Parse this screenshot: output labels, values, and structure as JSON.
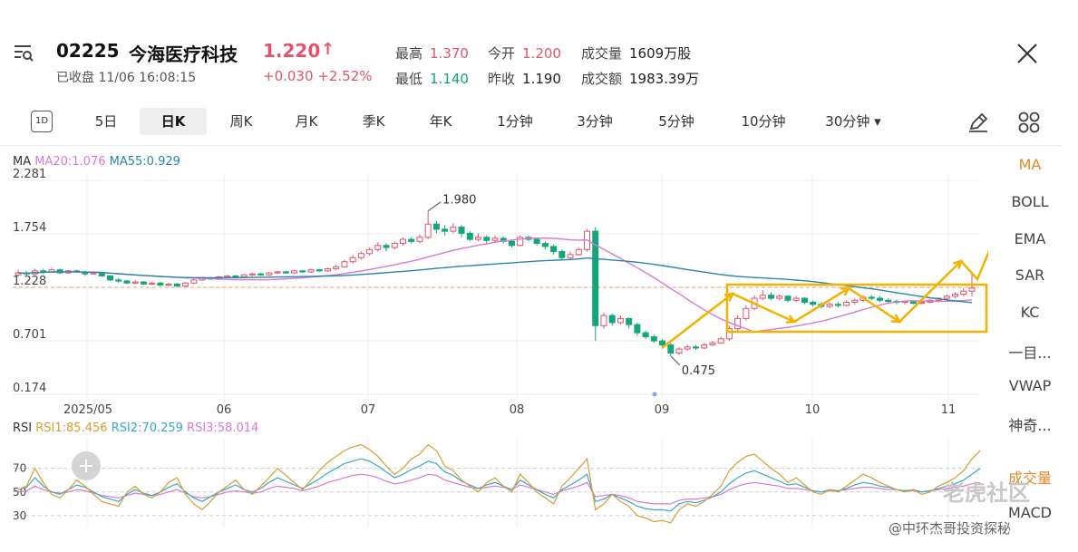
{
  "stock": {
    "code": "02225",
    "name": "今海医疗科技",
    "price": "1.220",
    "price_arrow": "↑",
    "status": "已收盘 11/06 16:08:15",
    "change": "+0.030 +2.52%"
  },
  "stats": {
    "high_label": "最高",
    "high_value": "1.370",
    "open_label": "今开",
    "open_value": "1.200",
    "volume_label": "成交量",
    "volume_value": "1609万股",
    "low_label": "最低",
    "low_value": "1.140",
    "prev_close_label": "昨收",
    "prev_close_value": "1.190",
    "turnover_label": "成交额",
    "turnover_value": "1983.39万"
  },
  "tabs": {
    "day1": "1D",
    "items": [
      "5日",
      "日K",
      "周K",
      "月K",
      "季K",
      "年K",
      "1分钟",
      "3分钟",
      "5分钟",
      "10分钟",
      "30分钟 ▾"
    ],
    "active": "日K"
  },
  "ma_legend": {
    "title": "MA",
    "ma20": "MA20:1.076",
    "ma55": "MA55:0.929"
  },
  "rsi_legend": {
    "title": "RSI",
    "rsi1": "RSI1:85.456",
    "rsi2": "RSI2:70.259",
    "rsi3": "RSI3:58.014"
  },
  "indicators": [
    "MA",
    "BOLL",
    "EMA",
    "SAR",
    "KC",
    "一目...",
    "VWAP",
    "神奇...",
    "成交量",
    "MACD"
  ],
  "colors": {
    "up": "#e0556b",
    "down": "#12a67a",
    "ma20": "#d67bd4",
    "ma55": "#2a86a8",
    "rsi1": "#d4a030",
    "rsi2": "#3aa8c8",
    "rsi3": "#d67bd4",
    "annotation": "#f0b400",
    "active_indicator": "#e08a2b"
  },
  "watermark": "老虎社区",
  "credit": "@中环杰哥投资探秘",
  "chart_data": {
    "type": "candlestick",
    "y_ticks": [
      "2.281",
      "1.754",
      "1.228",
      "0.701",
      "0.174"
    ],
    "y_range": [
      0.174,
      2.281
    ],
    "x_ticks": [
      "2025/05",
      "06",
      "07",
      "08",
      "09",
      "10",
      "11"
    ],
    "annotations": {
      "high_label": "1.980",
      "low_label": "0.475",
      "ref_line": 1.228
    },
    "rsi": {
      "y_ticks": [
        "70",
        "50",
        "30"
      ],
      "y_range": [
        20,
        95
      ]
    },
    "candles": [
      [
        1.35,
        1.37,
        1.4,
        1.33
      ],
      [
        1.37,
        1.36,
        1.39,
        1.34
      ],
      [
        1.36,
        1.39,
        1.41,
        1.35
      ],
      [
        1.39,
        1.38,
        1.41,
        1.36
      ],
      [
        1.38,
        1.4,
        1.42,
        1.37
      ],
      [
        1.4,
        1.37,
        1.41,
        1.36
      ],
      [
        1.37,
        1.39,
        1.4,
        1.36
      ],
      [
        1.39,
        1.38,
        1.4,
        1.37
      ],
      [
        1.38,
        1.36,
        1.39,
        1.34
      ],
      [
        1.36,
        1.37,
        1.38,
        1.35
      ],
      [
        1.37,
        1.34,
        1.38,
        1.33
      ],
      [
        1.34,
        1.3,
        1.35,
        1.29
      ],
      [
        1.3,
        1.29,
        1.32,
        1.27
      ],
      [
        1.29,
        1.27,
        1.3,
        1.26
      ],
      [
        1.27,
        1.28,
        1.3,
        1.26
      ],
      [
        1.28,
        1.26,
        1.29,
        1.25
      ],
      [
        1.26,
        1.27,
        1.28,
        1.25
      ],
      [
        1.27,
        1.25,
        1.28,
        1.24
      ],
      [
        1.25,
        1.26,
        1.27,
        1.24
      ],
      [
        1.26,
        1.24,
        1.27,
        1.23
      ],
      [
        1.24,
        1.27,
        1.28,
        1.23
      ],
      [
        1.27,
        1.3,
        1.31,
        1.26
      ],
      [
        1.3,
        1.32,
        1.33,
        1.29
      ],
      [
        1.32,
        1.31,
        1.33,
        1.3
      ],
      [
        1.31,
        1.33,
        1.34,
        1.3
      ],
      [
        1.33,
        1.34,
        1.35,
        1.32
      ],
      [
        1.34,
        1.33,
        1.35,
        1.32
      ],
      [
        1.33,
        1.35,
        1.36,
        1.32
      ],
      [
        1.35,
        1.36,
        1.37,
        1.34
      ],
      [
        1.36,
        1.35,
        1.37,
        1.34
      ],
      [
        1.35,
        1.37,
        1.38,
        1.34
      ],
      [
        1.37,
        1.38,
        1.39,
        1.36
      ],
      [
        1.38,
        1.37,
        1.39,
        1.36
      ],
      [
        1.37,
        1.39,
        1.4,
        1.36
      ],
      [
        1.39,
        1.38,
        1.4,
        1.37
      ],
      [
        1.38,
        1.4,
        1.41,
        1.37
      ],
      [
        1.4,
        1.39,
        1.41,
        1.38
      ],
      [
        1.39,
        1.41,
        1.42,
        1.38
      ],
      [
        1.41,
        1.43,
        1.45,
        1.4
      ],
      [
        1.43,
        1.48,
        1.5,
        1.42
      ],
      [
        1.48,
        1.52,
        1.55,
        1.46
      ],
      [
        1.52,
        1.56,
        1.58,
        1.5
      ],
      [
        1.56,
        1.6,
        1.62,
        1.54
      ],
      [
        1.6,
        1.64,
        1.67,
        1.58
      ],
      [
        1.64,
        1.62,
        1.66,
        1.58
      ],
      [
        1.62,
        1.66,
        1.68,
        1.6
      ],
      [
        1.66,
        1.7,
        1.72,
        1.64
      ],
      [
        1.7,
        1.68,
        1.72,
        1.66
      ],
      [
        1.68,
        1.72,
        1.75,
        1.66
      ],
      [
        1.72,
        1.85,
        1.98,
        1.7
      ],
      [
        1.85,
        1.8,
        1.88,
        1.76
      ],
      [
        1.8,
        1.78,
        1.84,
        1.74
      ],
      [
        1.78,
        1.82,
        1.86,
        1.76
      ],
      [
        1.82,
        1.76,
        1.84,
        1.72
      ],
      [
        1.76,
        1.7,
        1.78,
        1.68
      ],
      [
        1.7,
        1.72,
        1.76,
        1.68
      ],
      [
        1.72,
        1.69,
        1.74,
        1.66
      ],
      [
        1.69,
        1.71,
        1.74,
        1.67
      ],
      [
        1.71,
        1.68,
        1.73,
        1.66
      ],
      [
        1.68,
        1.64,
        1.7,
        1.62
      ],
      [
        1.64,
        1.72,
        1.74,
        1.63
      ],
      [
        1.72,
        1.7,
        1.74,
        1.68
      ],
      [
        1.7,
        1.66,
        1.72,
        1.64
      ],
      [
        1.66,
        1.63,
        1.68,
        1.6
      ],
      [
        1.63,
        1.58,
        1.65,
        1.55
      ],
      [
        1.58,
        1.52,
        1.6,
        1.5
      ],
      [
        1.52,
        1.55,
        1.58,
        1.5
      ],
      [
        1.55,
        1.6,
        1.62,
        1.54
      ],
      [
        1.6,
        1.78,
        1.8,
        1.58
      ],
      [
        1.78,
        0.85,
        1.82,
        0.7
      ],
      [
        0.85,
        0.95,
        0.98,
        0.82
      ],
      [
        0.95,
        0.88,
        0.97,
        0.85
      ],
      [
        0.88,
        0.92,
        0.95,
        0.86
      ],
      [
        0.92,
        0.86,
        0.93,
        0.82
      ],
      [
        0.86,
        0.78,
        0.88,
        0.75
      ],
      [
        0.78,
        0.74,
        0.8,
        0.72
      ],
      [
        0.74,
        0.7,
        0.76,
        0.68
      ],
      [
        0.7,
        0.66,
        0.72,
        0.64
      ],
      [
        0.66,
        0.58,
        0.68,
        0.55
      ],
      [
        0.58,
        0.62,
        0.64,
        0.56
      ],
      [
        0.62,
        0.64,
        0.66,
        0.6
      ],
      [
        0.64,
        0.63,
        0.66,
        0.61
      ],
      [
        0.63,
        0.66,
        0.68,
        0.62
      ],
      [
        0.66,
        0.68,
        0.7,
        0.65
      ],
      [
        0.68,
        0.72,
        0.74,
        0.67
      ],
      [
        0.72,
        0.82,
        0.85,
        0.7
      ],
      [
        0.82,
        0.92,
        0.95,
        0.8
      ],
      [
        0.92,
        1.02,
        1.05,
        0.9
      ],
      [
        1.02,
        1.12,
        1.15,
        1.0
      ],
      [
        1.12,
        1.15,
        1.2,
        1.1
      ],
      [
        1.15,
        1.12,
        1.18,
        1.1
      ],
      [
        1.12,
        1.14,
        1.16,
        1.1
      ],
      [
        1.14,
        1.1,
        1.15,
        1.08
      ],
      [
        1.1,
        1.12,
        1.14,
        1.08
      ],
      [
        1.12,
        1.08,
        1.13,
        1.06
      ],
      [
        1.08,
        1.06,
        1.1,
        1.04
      ],
      [
        1.06,
        1.04,
        1.08,
        1.02
      ],
      [
        1.04,
        1.06,
        1.08,
        1.02
      ],
      [
        1.06,
        1.05,
        1.08,
        1.03
      ],
      [
        1.05,
        1.08,
        1.1,
        1.04
      ],
      [
        1.08,
        1.1,
        1.12,
        1.06
      ],
      [
        1.1,
        1.13,
        1.15,
        1.08
      ],
      [
        1.13,
        1.12,
        1.15,
        1.1
      ],
      [
        1.12,
        1.1,
        1.14,
        1.08
      ],
      [
        1.1,
        1.09,
        1.12,
        1.07
      ],
      [
        1.09,
        1.08,
        1.11,
        1.06
      ],
      [
        1.08,
        1.09,
        1.1,
        1.06
      ],
      [
        1.09,
        1.07,
        1.1,
        1.06
      ],
      [
        1.07,
        1.08,
        1.09,
        1.06
      ],
      [
        1.08,
        1.1,
        1.11,
        1.07
      ],
      [
        1.1,
        1.12,
        1.13,
        1.08
      ],
      [
        1.12,
        1.14,
        1.16,
        1.1
      ],
      [
        1.14,
        1.16,
        1.18,
        1.12
      ],
      [
        1.16,
        1.19,
        1.22,
        1.14
      ],
      [
        1.19,
        1.22,
        1.37,
        1.14
      ]
    ],
    "rsi1": [
      52,
      55,
      70,
      58,
      48,
      45,
      52,
      60,
      55,
      48,
      42,
      40,
      38,
      50,
      55,
      48,
      45,
      50,
      58,
      62,
      48,
      40,
      35,
      42,
      50,
      55,
      60,
      52,
      48,
      55,
      62,
      70,
      64,
      58,
      52,
      60,
      68,
      75,
      80,
      85,
      88,
      90,
      86,
      80,
      72,
      65,
      70,
      78,
      82,
      90,
      85,
      72,
      68,
      60,
      55,
      50,
      58,
      62,
      55,
      50,
      65,
      58,
      50,
      45,
      40,
      55,
      62,
      70,
      78,
      35,
      40,
      48,
      42,
      38,
      30,
      28,
      25,
      26,
      24,
      35,
      40,
      38,
      42,
      48,
      55,
      68,
      75,
      80,
      82,
      76,
      70,
      65,
      58,
      62,
      56,
      50,
      48,
      52,
      50,
      55,
      60,
      65,
      62,
      58,
      55,
      52,
      50,
      52,
      48,
      50,
      55,
      58,
      62,
      68,
      78,
      85
    ],
    "rsi2": [
      52,
      54,
      62,
      55,
      50,
      48,
      52,
      56,
      54,
      50,
      46,
      44,
      42,
      48,
      52,
      49,
      47,
      50,
      54,
      57,
      50,
      45,
      42,
      46,
      50,
      53,
      56,
      52,
      50,
      53,
      58,
      62,
      59,
      56,
      53,
      57,
      61,
      66,
      70,
      74,
      76,
      78,
      76,
      72,
      67,
      62,
      65,
      69,
      72,
      76,
      74,
      67,
      64,
      59,
      56,
      53,
      56,
      58,
      55,
      52,
      60,
      56,
      52,
      48,
      45,
      52,
      56,
      60,
      65,
      42,
      44,
      48,
      45,
      42,
      38,
      36,
      35,
      35,
      34,
      40,
      42,
      41,
      43,
      46,
      50,
      57,
      62,
      66,
      68,
      65,
      62,
      59,
      56,
      57,
      54,
      51,
      50,
      52,
      51,
      53,
      56,
      58,
      57,
      55,
      54,
      52,
      51,
      52,
      50,
      51,
      53,
      55,
      57,
      60,
      65,
      70
    ],
    "rsi3": [
      50,
      51,
      55,
      52,
      50,
      49,
      50,
      52,
      51,
      49,
      47,
      46,
      45,
      47,
      49,
      48,
      47,
      48,
      50,
      52,
      49,
      46,
      45,
      46,
      48,
      50,
      51,
      50,
      49,
      50,
      53,
      55,
      54,
      53,
      51,
      53,
      55,
      58,
      60,
      62,
      64,
      65,
      64,
      62,
      59,
      57,
      58,
      60,
      62,
      65,
      64,
      60,
      58,
      56,
      54,
      53,
      54,
      55,
      54,
      52,
      56,
      54,
      52,
      50,
      48,
      51,
      53,
      55,
      58,
      46,
      47,
      48,
      47,
      45,
      42,
      41,
      40,
      40,
      40,
      43,
      44,
      44,
      45,
      46,
      48,
      52,
      55,
      57,
      58,
      57,
      56,
      55,
      53,
      53,
      52,
      51,
      50,
      51,
      51,
      52,
      53,
      54,
      54,
      53,
      52,
      52,
      51,
      51,
      50,
      51,
      52,
      53,
      54,
      55,
      57,
      58
    ]
  }
}
